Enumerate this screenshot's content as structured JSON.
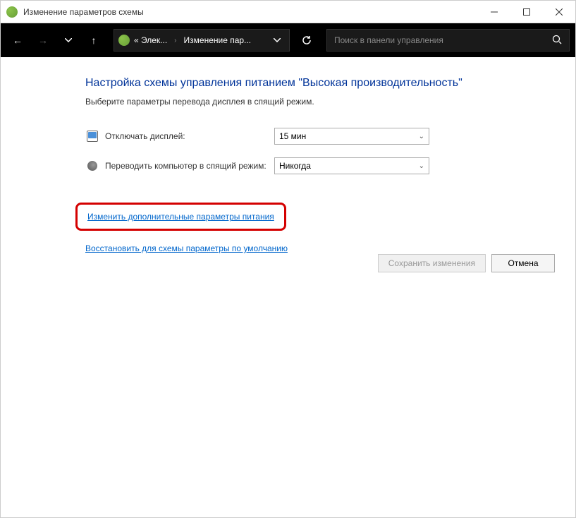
{
  "window": {
    "title": "Изменение параметров схемы"
  },
  "breadcrumb": {
    "part1": "« Элек...",
    "part2": "Изменение пар..."
  },
  "search": {
    "placeholder": "Поиск в панели управления"
  },
  "page": {
    "heading": "Настройка схемы управления питанием \"Высокая производительность\"",
    "description": "Выберите параметры перевода дисплея в спящий режим."
  },
  "settings": {
    "display_off": {
      "label": "Отключать дисплей:",
      "value": "15 мин"
    },
    "sleep": {
      "label": "Переводить компьютер в спящий режим:",
      "value": "Никогда"
    }
  },
  "links": {
    "advanced": "Изменить дополнительные параметры питания",
    "restore": "Восстановить для схемы параметры по умолчанию"
  },
  "buttons": {
    "save": "Сохранить изменения",
    "cancel": "Отмена"
  }
}
